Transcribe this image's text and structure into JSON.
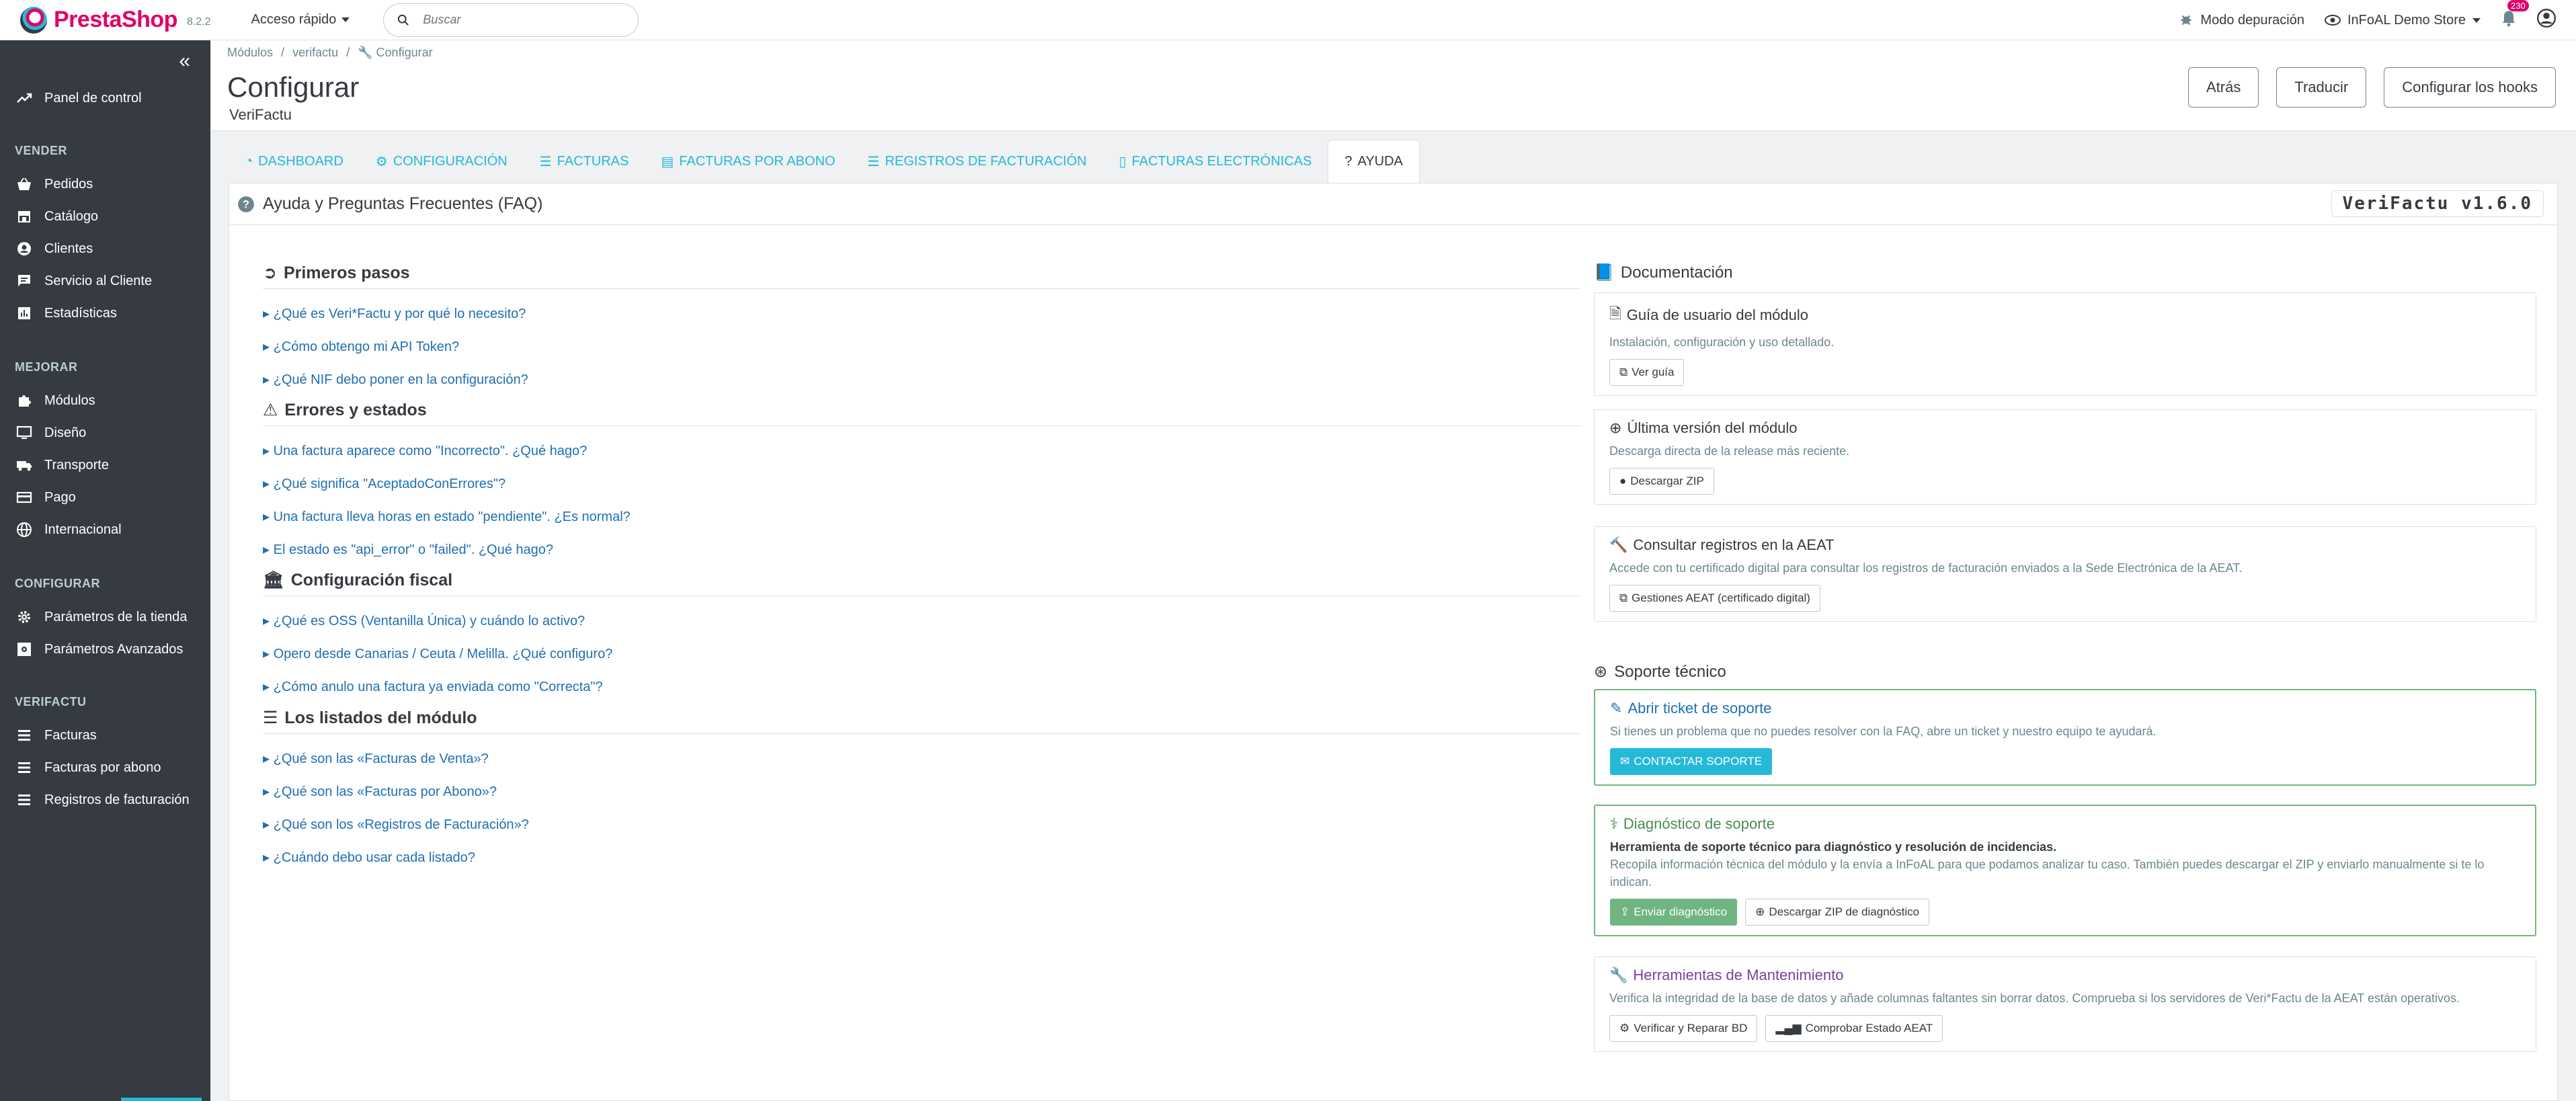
{
  "topbar": {
    "brand": "PrestaShop",
    "version": "8.2.2",
    "quick_access": "Acceso rápido",
    "search_placeholder": "Buscar",
    "debug_mode": "Modo depuración",
    "store_name": "InFoAL Demo Store",
    "notifications_count": "230"
  },
  "sidebar": {
    "dashboard": "Panel de control",
    "sections": [
      {
        "title": "VENDER",
        "items": [
          "Pedidos",
          "Catálogo",
          "Clientes",
          "Servicio al Cliente",
          "Estadísticas"
        ]
      },
      {
        "title": "MEJORAR",
        "items": [
          "Módulos",
          "Diseño",
          "Transporte",
          "Pago",
          "Internacional"
        ]
      },
      {
        "title": "CONFIGURAR",
        "items": [
          "Parámetros de la tienda",
          "Parámetros Avanzados"
        ]
      },
      {
        "title": "VERIFACTU",
        "items": [
          "Facturas",
          "Facturas por abono",
          "Registros de facturación"
        ]
      }
    ]
  },
  "header": {
    "breadcrumb": [
      "Módulos",
      "verifactu",
      "Configurar"
    ],
    "title": "Configurar",
    "subtitle": "VeriFactu",
    "buttons": {
      "back": "Atrás",
      "translate": "Traducir",
      "hooks": "Configurar los hooks"
    }
  },
  "tabs": [
    "DASHBOARD",
    "CONFIGURACIÓN",
    "FACTURAS",
    "FACTURAS POR ABONO",
    "REGISTROS DE FACTURACIÓN",
    "FACTURAS ELECTRÓNICAS",
    "AYUDA"
  ],
  "panel": {
    "title": "Ayuda y Preguntas Frecuentes (FAQ)",
    "version": "VeriFactu v1.6.0"
  },
  "faq": [
    {
      "title": "Primeros pasos",
      "questions": [
        "¿Qué es Veri*Factu y por qué lo necesito?",
        "¿Cómo obtengo mi API Token?",
        "¿Qué NIF debo poner en la configuración?"
      ]
    },
    {
      "title": "Errores y estados",
      "questions": [
        "Una factura aparece como \"Incorrecto\". ¿Qué hago?",
        "¿Qué significa \"AceptadoConErrores\"?",
        "Una factura lleva horas en estado \"pendiente\". ¿Es normal?",
        "El estado es \"api_error\" o \"failed\". ¿Qué hago?"
      ]
    },
    {
      "title": "Configuración fiscal",
      "questions": [
        "¿Qué es OSS (Ventanilla Única) y cuándo lo activo?",
        "Opero desde Canarias / Ceuta / Melilla. ¿Qué configuro?",
        "¿Cómo anulo una factura ya enviada como \"Correcta\"?"
      ]
    },
    {
      "title": "Los listados del módulo",
      "questions": [
        "¿Qué son las «Facturas de Venta»?",
        "¿Qué son las «Facturas por Abono»?",
        "¿Qué son los «Registros de Facturación»?",
        "¿Cuándo debo usar cada listado?"
      ]
    }
  ],
  "documentation": {
    "heading": "Documentación",
    "guide": {
      "title": "Guía de usuario del módulo",
      "text": "Instalación, configuración y uso detallado.",
      "button": "Ver guía"
    },
    "latest": {
      "title": "Última versión del módulo",
      "text": "Descarga directa de la release más reciente.",
      "button": "Descargar ZIP"
    },
    "aeat": {
      "title": "Consultar registros en la AEAT",
      "text": "Accede con tu certificado digital para consultar los registros de facturación enviados a la Sede Electrónica de la AEAT.",
      "button": "Gestiones AEAT (certificado digital)"
    }
  },
  "support": {
    "heading": "Soporte técnico",
    "ticket": {
      "title": "Abrir ticket de soporte",
      "text": "Si tienes un problema que no puedes resolver con la FAQ, abre un ticket y nuestro equipo te ayudará.",
      "button": "CONTACTAR SOPORTE"
    },
    "diagnostic": {
      "title": "Diagnóstico de soporte",
      "bold": "Herramienta de soporte técnico para diagnóstico y resolución de incidencias.",
      "text": "Recopila información técnica del módulo y la envía a InFoAL para que podamos analizar tu caso. También puedes descargar el ZIP y enviarlo manualmente si te lo indican.",
      "button_send": "Enviar diagnóstico",
      "button_zip": "Descargar ZIP de diagnóstico"
    },
    "maintenance": {
      "title": "Herramientas de Mantenimiento",
      "text": "Verifica la integridad de la base de datos y añade columnas faltantes sin borrar datos. Comprueba si los servidores de Veri*Factu de la AEAT están operativos.",
      "button_repair": "Verificar y Reparar BD",
      "button_status": "Comprobar Estado AEAT"
    }
  },
  "colors": {
    "sidebar": "#363a41",
    "accent": "#25b9d7",
    "brand": "#df0067",
    "success": "#70b580",
    "link": "#1f6fb2"
  }
}
